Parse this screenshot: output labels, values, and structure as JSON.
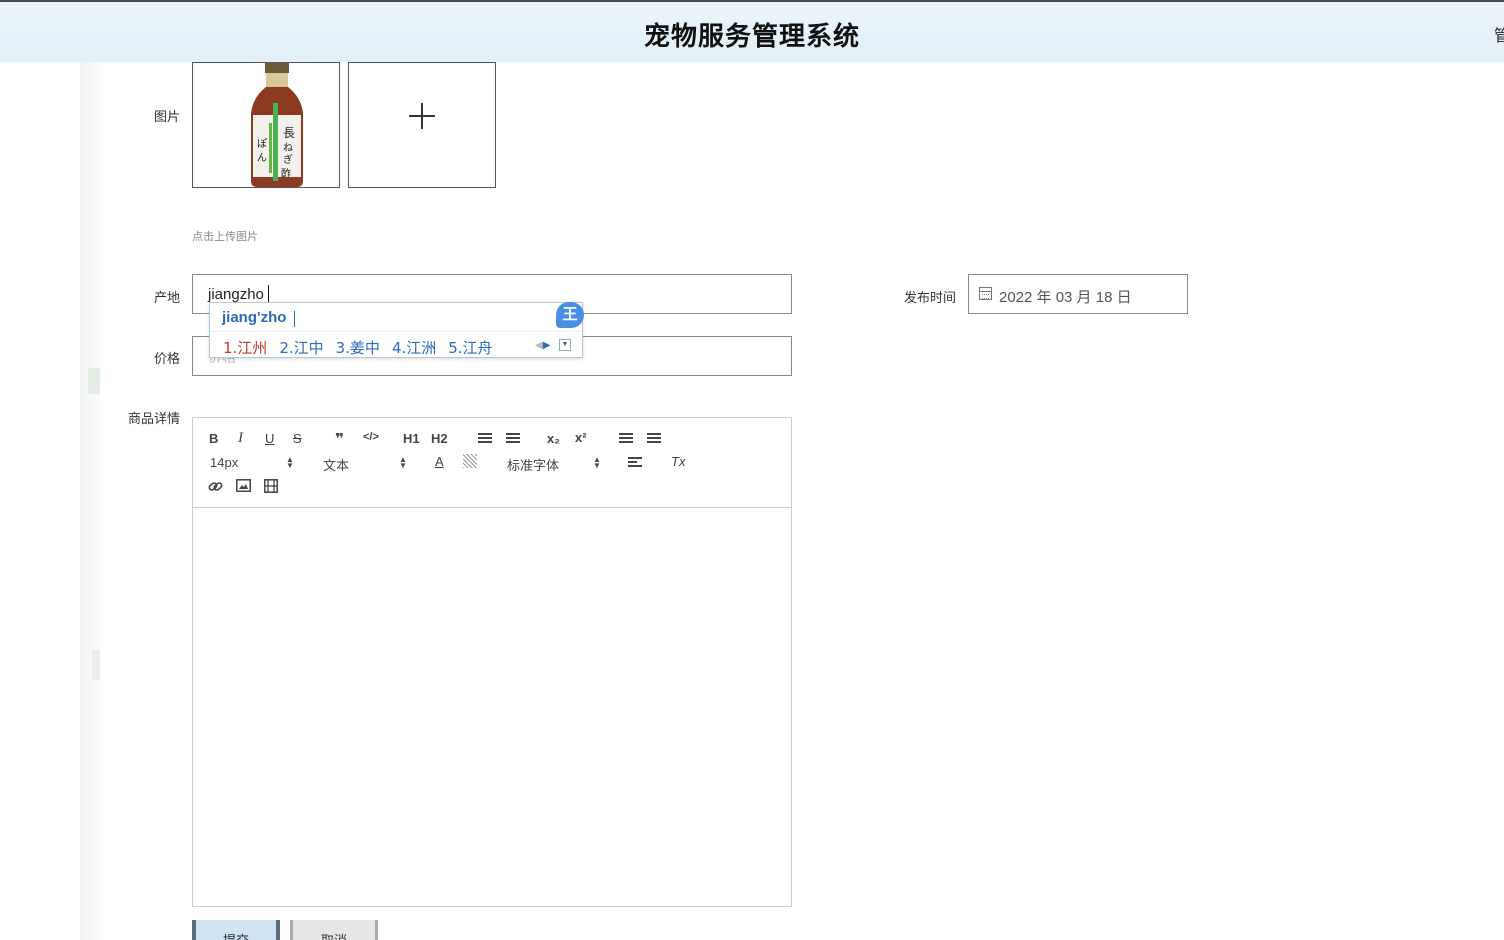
{
  "header": {
    "title": "宠物服务管理系统",
    "user_partial": "管"
  },
  "form": {
    "image": {
      "label": "图片",
      "hint": "点击上传图片"
    },
    "origin": {
      "label": "产地",
      "value": "jiangzho"
    },
    "publish_time": {
      "label": "发布时间",
      "value": "2022 年 03 月 18 日"
    },
    "price": {
      "label": "价格",
      "placeholder": "价格"
    },
    "details": {
      "label": "商品详情"
    }
  },
  "ime": {
    "composition": "jiang'zho",
    "badge": "王",
    "candidates": [
      "1.江州",
      "2.江中",
      "3.姜中",
      "4.江洲",
      "5.江舟"
    ]
  },
  "editor": {
    "toolbar": {
      "bold": "B",
      "italic": "I",
      "underline": "U",
      "strike": "S",
      "quote": "❞",
      "code": "</>",
      "h1": "H1",
      "h2": "H2",
      "sub": "x₂",
      "sup": "x²",
      "size": "14px",
      "header_select": "文本",
      "font_select": "标准字体",
      "color": "A",
      "clean": "Tx"
    }
  },
  "actions": {
    "submit": "提交",
    "cancel": "取消"
  }
}
